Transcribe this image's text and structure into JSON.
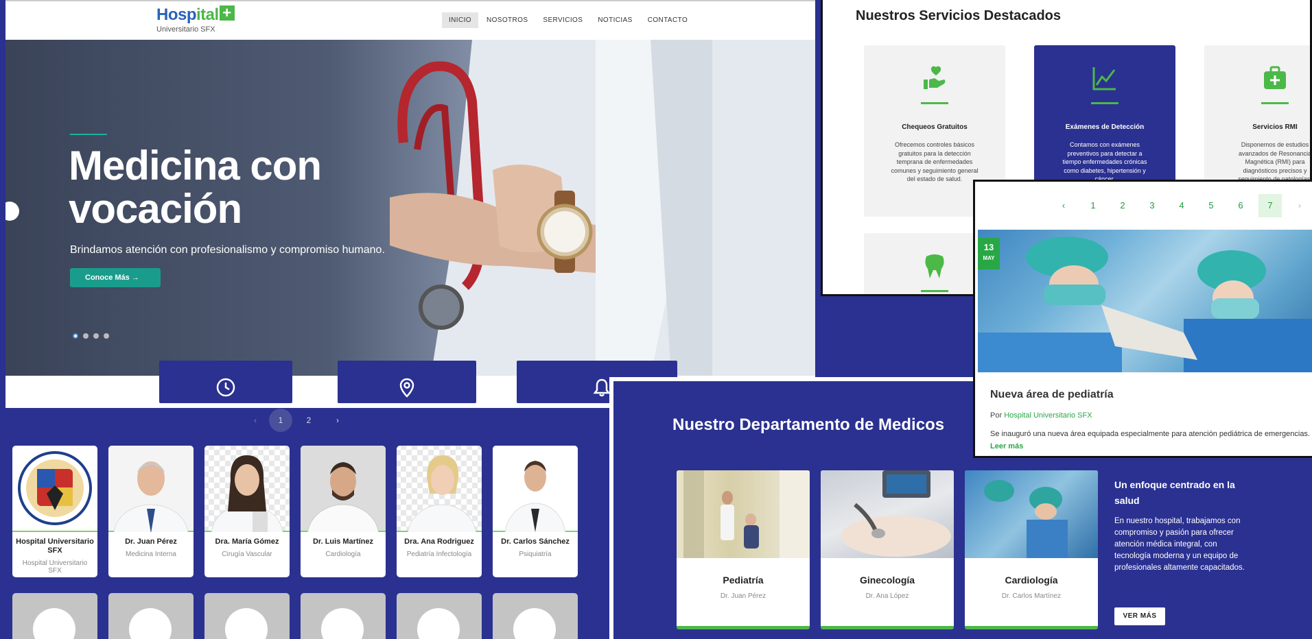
{
  "header": {
    "logo_word1": "Hosp",
    "logo_word2": "ital",
    "logo_plus": "+",
    "logo_sub": "Universitario SFX",
    "nav": [
      "INICIO",
      "NOSOTROS",
      "SERVICIOS",
      "NOTICIAS",
      "CONTACTO"
    ]
  },
  "hero": {
    "title": "Medicina con vocación",
    "subtitle": "Brindamos atención con profesionalismo y compromiso humano.",
    "cta": "Conoce Más",
    "slides": 4,
    "active_slide": 1
  },
  "doctors": {
    "pagination": {
      "prev": "‹",
      "pages": [
        "1",
        "2"
      ],
      "next": "›",
      "active": "1"
    },
    "cards": [
      {
        "name": "Hospital Universitario SFX",
        "role": "Hospital Universitario SFX",
        "photo": "seal"
      },
      {
        "name": "Dr. Juan Pérez",
        "role": "Medicina Interna",
        "photo": "doctor"
      },
      {
        "name": "Dra. María Gómez",
        "role": "Cirugía Vascular",
        "photo": "doctor"
      },
      {
        "name": "Dr. Luis Martínez",
        "role": "Cardiología",
        "photo": "doctor"
      },
      {
        "name": "Dra. Ana Rodriguez",
        "role": "Pediatría Infectología",
        "photo": "doctor"
      },
      {
        "name": "Dr. Carlos Sánchez",
        "role": "Psiquiatría",
        "photo": "doctor"
      }
    ]
  },
  "services": {
    "title": "Nuestros Servicios Destacados",
    "items": [
      {
        "icon": "hand-heart-icon",
        "title": "Chequeos Gratuitos",
        "desc": "Ofrecemos controles básicos gratuitos para la detección temprana de enfermedades comunes y seguimiento general del estado de salud."
      },
      {
        "icon": "chart-line-icon",
        "title": "Exámenes de Detección",
        "desc": "Contamos con exámenes preventivos para detectar a tiempo enfermedades crónicas como diabetes, hipertensión y cáncer."
      },
      {
        "icon": "medkit-icon",
        "title": "Servicios RMI",
        "desc": "Disponemos de estudios avanzados de Resonancia Magnética (RMI) para diagnósticos precisos y seguimiento de patologías."
      }
    ],
    "fourth_icon": "tooth-icon"
  },
  "news": {
    "pagination": {
      "prev": "‹",
      "pages": [
        "1",
        "2",
        "3",
        "4",
        "5",
        "6",
        "7"
      ],
      "next": "›",
      "active": "7"
    },
    "date_day": "13",
    "date_month": "MAY",
    "title": "Nueva área de pediatría",
    "by_prefix": "Por ",
    "author": "Hospital Universitario SFX",
    "excerpt": "Se inauguró una nueva área equipada especialmente para atención pediátrica de emergencias.",
    "more": "Leer más"
  },
  "departments": {
    "title": "Nuestro Departamento de Medicos",
    "items": [
      {
        "name": "Pediatría",
        "doctor": "Dr. Juan Pérez"
      },
      {
        "name": "Ginecología",
        "doctor": "Dr. Ana López"
      },
      {
        "name": "Cardiología",
        "doctor": "Dr. Carlos Martínez"
      }
    ],
    "side_title": "Un enfoque centrado en la salud",
    "side_text": "En nuestro hospital, trabajamos con compromiso y pasión para ofrecer atención médica integral, con tecnología moderna y un equipo de profesionales altamente capacitados.",
    "button": "VER MÁS"
  },
  "colors": {
    "brand_blue": "#2b3190",
    "accent_green": "#4cb848",
    "teal": "#1a9c8c"
  }
}
